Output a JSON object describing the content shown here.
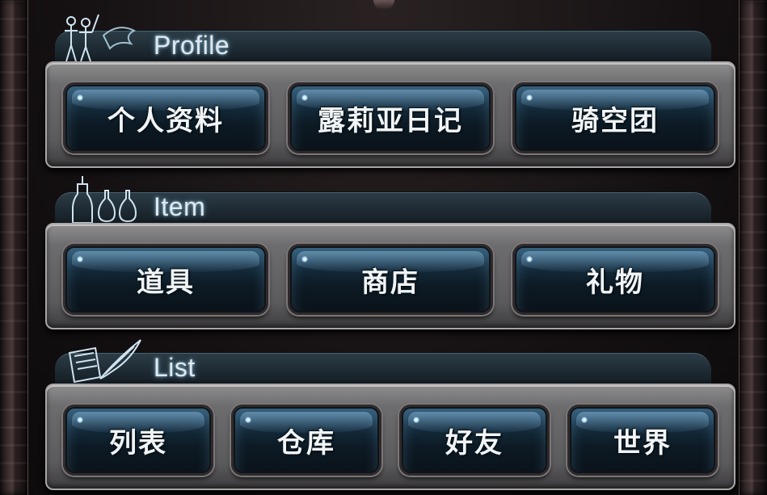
{
  "sections": [
    {
      "title": "Profile",
      "icon": "knights-icon",
      "buttons": [
        "个人资料",
        "露莉亚日记",
        "骑空团"
      ]
    },
    {
      "title": "Item",
      "icon": "potion-bottles-icon",
      "buttons": [
        "道具",
        "商店",
        "礼物"
      ]
    },
    {
      "title": "List",
      "icon": "book-quill-icon",
      "buttons": [
        "列表",
        "仓库",
        "好友",
        "世界"
      ]
    }
  ],
  "colors": {
    "button_fill": "#142a3a",
    "button_highlight": "#6ea6d2",
    "panel_metal": "#6d6c6e",
    "tab_bg": "#1a252d",
    "title_glow": "#9fc6dc"
  }
}
